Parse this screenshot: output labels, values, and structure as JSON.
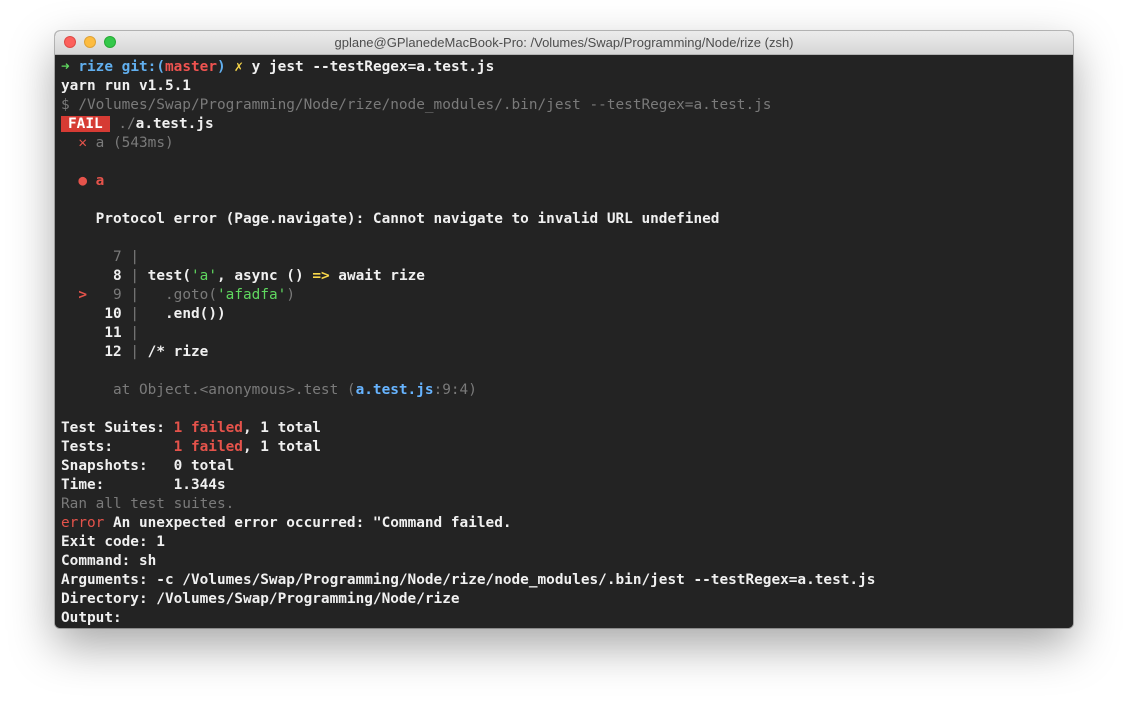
{
  "window": {
    "title": "gplane@GPlanedeMacBook-Pro: /Volumes/Swap/Programming/Node/rize (zsh)"
  },
  "prompt": {
    "arrow": "➜",
    "dir": "rize",
    "git": "git:(",
    "branch": "master",
    "git_close": ")",
    "dirty": "✗",
    "command": "y jest --testRegex=a.test.js"
  },
  "yarn": {
    "version_line": "yarn run v1.5.1",
    "exec_line": "$ /Volumes/Swap/Programming/Node/rize/node_modules/.bin/jest --testRegex=a.test.js"
  },
  "result": {
    "badge": "FAIL",
    "file_dir": "./",
    "file_name": "a.test.js"
  },
  "test": {
    "cross": "✕",
    "name": "a",
    "duration": "(543ms)"
  },
  "failure": {
    "bullet": "●",
    "title": "a",
    "message": "Protocol error (Page.navigate): Cannot navigate to invalid URL undefined"
  },
  "code": {
    "l7": {
      "num": "7",
      "sep": "|"
    },
    "l8": {
      "num": "8",
      "sep": "|",
      "pre": "test(",
      "str": "'a'",
      "mid": ", async () ",
      "arrow": "=>",
      "post": " await rize"
    },
    "l9": {
      "marker": ">",
      "num": "9",
      "sep": "|",
      "pre": ".goto(",
      "str": "'afadfa'",
      "post": ")"
    },
    "l10": {
      "num": "10",
      "sep": "|",
      "text": ".end())"
    },
    "l11": {
      "num": "11",
      "sep": "|"
    },
    "l12": {
      "num": "12",
      "sep": "|",
      "text": "/* rize"
    }
  },
  "stack": {
    "pre": "at Object.<anonymous>.test (",
    "file": "a.test.js",
    "loc": ":9:4)"
  },
  "summary": {
    "suites_label": "Test Suites:",
    "suites_failed": "1 failed",
    "suites_total": ", 1 total",
    "tests_label": "Tests:",
    "tests_failed": "1 failed",
    "tests_total": ", 1 total",
    "snapshots_label": "Snapshots:",
    "snapshots_value": "0 total",
    "time_label": "Time:",
    "time_value": "1.344s",
    "ran": "Ran all test suites."
  },
  "error": {
    "label": "error",
    "message": " An unexpected error occurred: \"Command failed.",
    "exit": "Exit code: 1",
    "command": "Command: sh",
    "arguments": "Arguments: -c /Volumes/Swap/Programming/Node/rize/node_modules/.bin/jest --testRegex=a.test.js",
    "directory": "Directory: /Volumes/Swap/Programming/Node/rize",
    "output": "Output:"
  }
}
